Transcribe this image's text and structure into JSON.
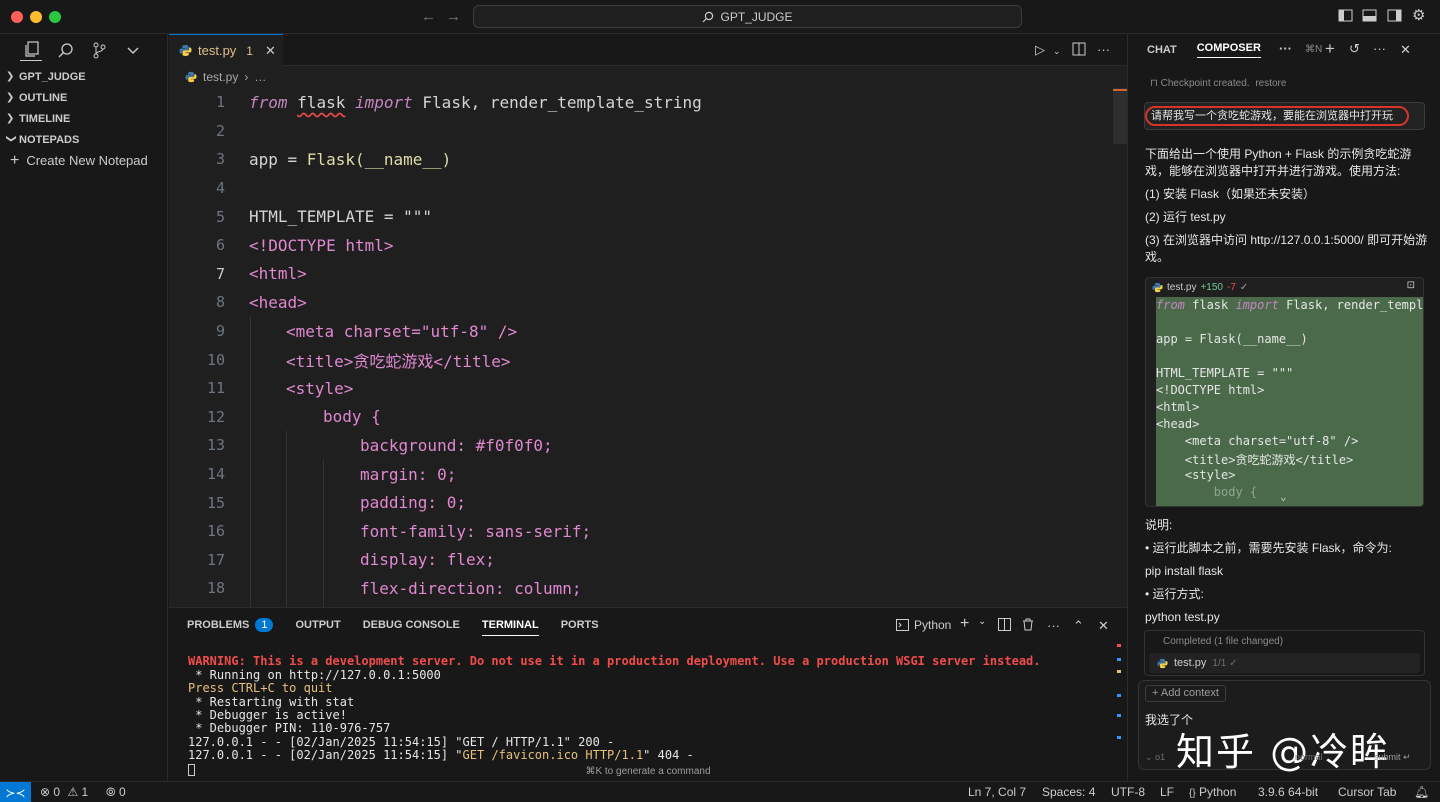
{
  "titlebar": {
    "title": "GPT_JUDGE"
  },
  "sidebar": {
    "sections": [
      {
        "label": "GPT_JUDGE"
      },
      {
        "label": "OUTLINE"
      },
      {
        "label": "TIMELINE"
      },
      {
        "label": "NOTEPADS"
      }
    ],
    "create_notepad": "Create New Notepad"
  },
  "editor": {
    "tab": {
      "label": "test.py",
      "problems": "1"
    },
    "breadcrumb": {
      "file": "test.py",
      "more": "…"
    },
    "lines": [
      {
        "n": "1"
      },
      {
        "n": "2"
      },
      {
        "n": "3"
      },
      {
        "n": "4"
      },
      {
        "n": "5"
      },
      {
        "n": "6"
      },
      {
        "n": "7"
      },
      {
        "n": "8"
      },
      {
        "n": "9"
      },
      {
        "n": "10"
      },
      {
        "n": "11"
      },
      {
        "n": "12"
      },
      {
        "n": "13"
      },
      {
        "n": "14"
      },
      {
        "n": "15"
      },
      {
        "n": "16"
      },
      {
        "n": "17"
      },
      {
        "n": "18"
      }
    ],
    "code": {
      "l1_from": "from",
      "l1_mod": "flask",
      "l1_import": "import",
      "l1_rest": " Flask, render_template_string",
      "l3_app": "app = ",
      "l3_flask": "Flask(",
      "l3_name": "__name__",
      "l3_close": ")",
      "l5": "HTML_TEMPLATE = \"\"\"",
      "l6": "<!DOCTYPE html>",
      "l7": "<html>",
      "l8": "<head>",
      "l9": "<meta charset=\"utf-8\" />",
      "l10": "<title>贪吃蛇游戏</title>",
      "l11": "<style>",
      "l12": "body {",
      "l13": "background: #f0f0f0;",
      "l14": "margin: 0;",
      "l15": "padding: 0;",
      "l16": "font-family: sans-serif;",
      "l17": "display: flex;",
      "l18": "flex-direction: column;"
    }
  },
  "panel": {
    "tabs": [
      {
        "label": "PROBLEMS",
        "badge": "1"
      },
      {
        "label": "OUTPUT"
      },
      {
        "label": "DEBUG CONSOLE"
      },
      {
        "label": "TERMINAL"
      },
      {
        "label": "PORTS"
      }
    ],
    "terminal_profile": "Python",
    "terminal": {
      "l1": "WARNING: This is a development server. Do not use it in a production deployment. Use a production WSGI server instead.",
      "l2": " * Running on http://127.0.0.1:5000",
      "l3": "Press CTRL+C to quit",
      "l4": " * Restarting with stat",
      "l5": " * Debugger is active!",
      "l6": " * Debugger PIN: 110-976-757",
      "l7a": "127.0.0.1 - - [02/Jan/2025 11:54:15] \"GET / HTTP/1.1\" 200 -",
      "l8a": "127.0.0.1 - - [02/Jan/2025 11:54:15] \"",
      "l8b": "GET /favicon.ico HTTP/1.1",
      "l8c": "\" 404 -"
    },
    "generate_hint": "⌘K to generate a command"
  },
  "chat": {
    "tabs": [
      {
        "label": "CHAT"
      },
      {
        "label": "COMPOSER"
      }
    ],
    "shortcut": "⌘N",
    "checkpoint": "Checkpoint created.",
    "restore": "restore",
    "user_message": "请帮我写一个贪吃蛇游戏，要能在浏览器中打开玩",
    "response": {
      "p1": "下面给出一个使用 Python + Flask 的示例贪吃蛇游戏，能够在浏览器中打开并进行游戏。使用方法:",
      "p2": "(1) 安装 Flask（如果还未安装）",
      "p3": "(2) 运行 test.py",
      "p4": "(3) 在浏览器中访问 http://127.0.0.1:5000/ 即可开始游戏。",
      "notes_title": "说明:",
      "n1": "• 运行此脚本之前，需要先安装 Flask，命令为:",
      "n2": "pip install flask",
      "n3": "• 运行方式:",
      "n4": "python test.py"
    },
    "code_block": {
      "file": "test.py",
      "added": "+150",
      "removed": "-7",
      "check": "✓",
      "lines": [
        {
          "t": "app = Flask(__name__)"
        },
        {
          "t": "HTML_TEMPLATE = \"\"\""
        },
        {
          "t": "<!DOCTYPE html>"
        },
        {
          "t": "<html>"
        },
        {
          "t": "<head>"
        },
        {
          "t": "    <meta charset=\"utf-8\" />"
        },
        {
          "t": "    <title>贪吃蛇游戏</title>"
        },
        {
          "t": "    <style>"
        },
        {
          "t": "        body {"
        }
      ],
      "l1_from": "from",
      "l1_mid": " flask ",
      "l1_import": "import",
      "l1_rest": " Flask, render_templat"
    },
    "completed": {
      "header": "Completed",
      "changed": "(1 file changed)",
      "file": "test.py",
      "status": "1/1 ✓"
    },
    "composer": {
      "add_context": "+ Add context",
      "input": "我选了个",
      "model": "o1",
      "mode": "normal",
      "submit": "submit"
    },
    "watermark": "知乎 @冷眸"
  },
  "statusbar": {
    "errors": "0",
    "warnings": "1",
    "ports": "0",
    "position": "Ln 7, Col 7",
    "spaces": "Spaces: 4",
    "encoding": "UTF-8",
    "eol": "LF",
    "language": "Python",
    "interpreter": "3.9.6 64-bit",
    "cursor_tab": "Cursor Tab"
  }
}
